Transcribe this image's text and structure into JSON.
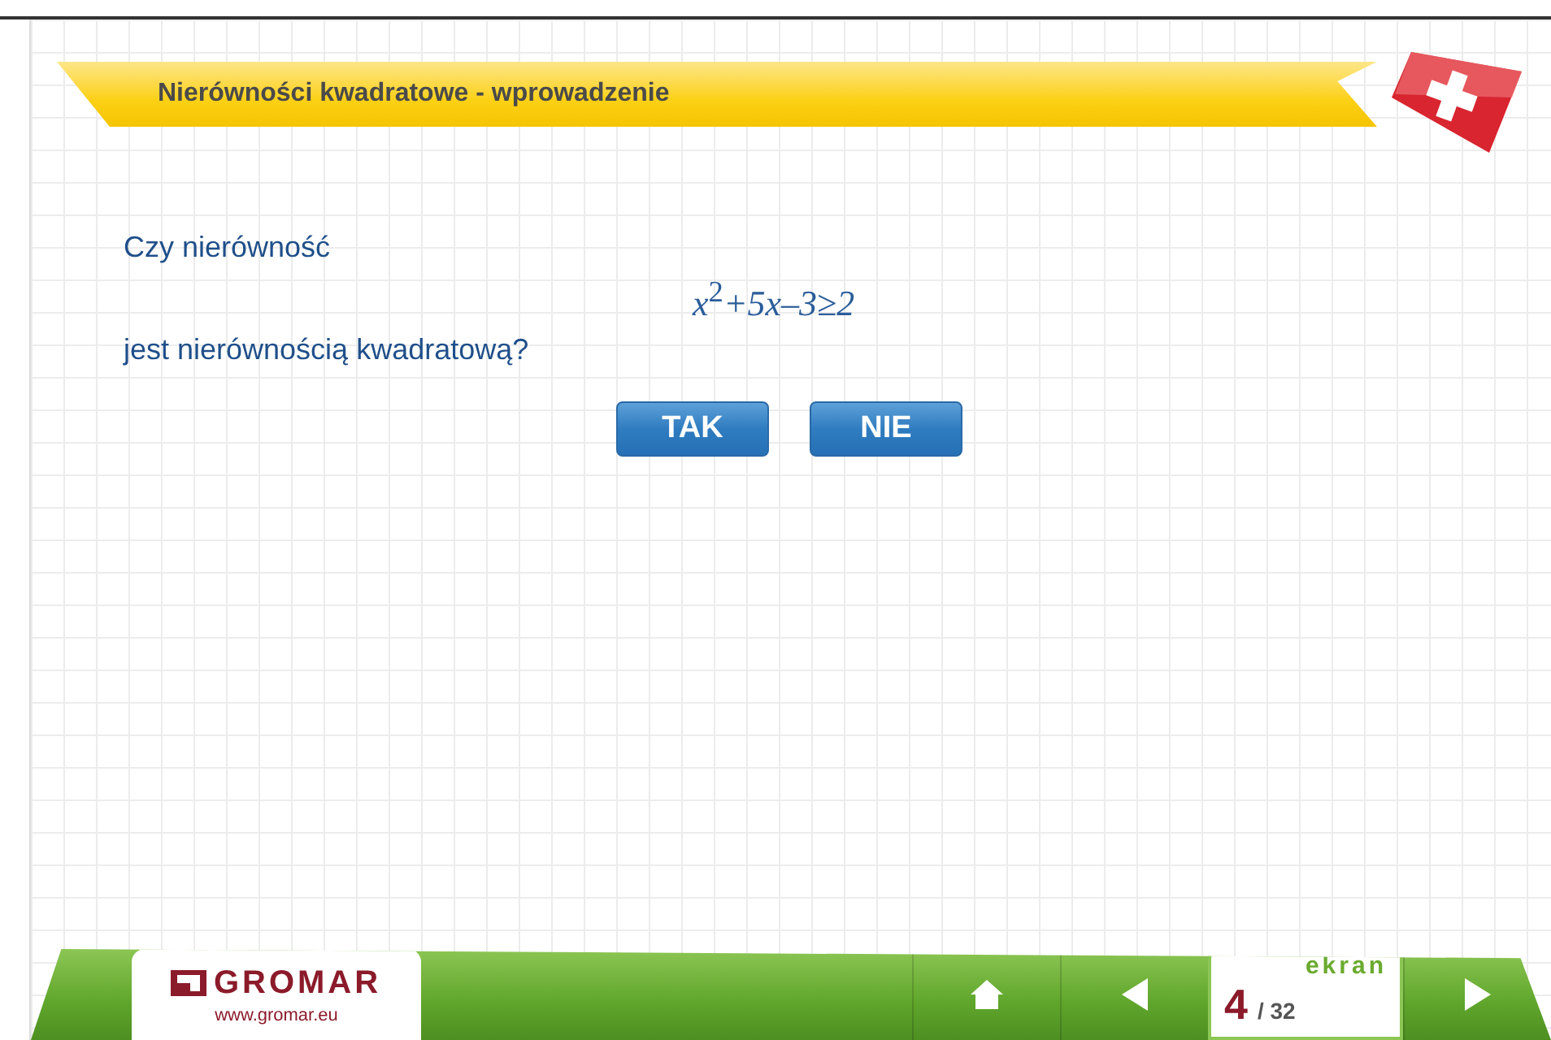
{
  "header": {
    "title": "Nierówności kwadratowe - wprowadzenie"
  },
  "question": {
    "intro": "Czy nierówność",
    "formula": "*x*$^{2}$*+5x–3≥2*",
    "outro": "jest nierównością kwadratową?"
  },
  "answers": [
    {
      "label": "TAK"
    },
    {
      "label": "NIE"
    }
  ],
  "footer": {
    "logo": "GROMAR",
    "url": "www.gromar.eu",
    "screen_label": "ekran",
    "screen_current": "4",
    "screen_total": "/ 32"
  }
}
